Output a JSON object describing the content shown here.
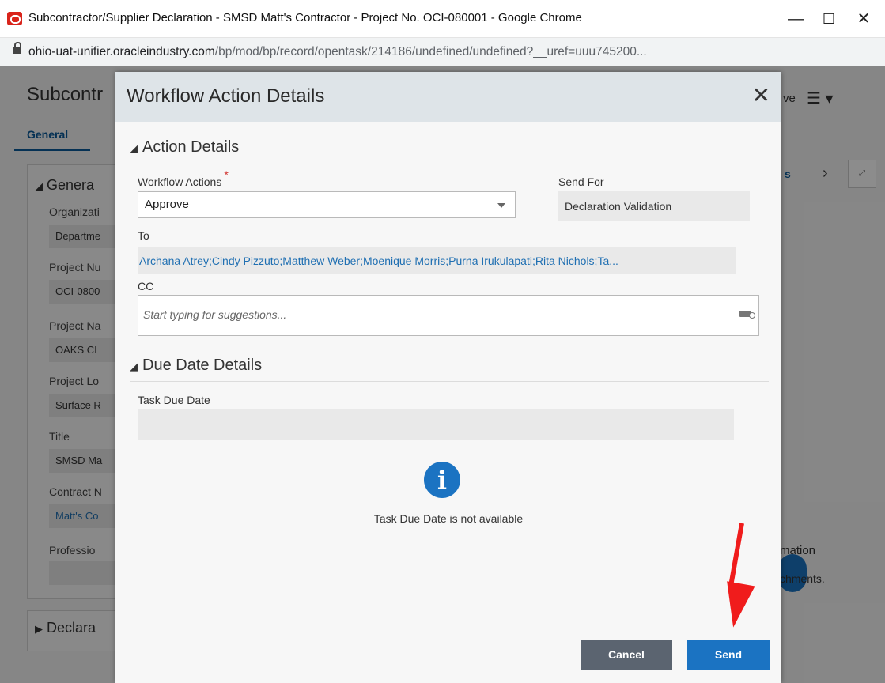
{
  "window": {
    "title": "Subcontractor/Supplier Declaration - SMSD Matt's Contractor - Project No. OCI-080001 - Google Chrome",
    "minimize": "—",
    "maximize": "☐",
    "close": "✕"
  },
  "address": {
    "domain": "ohio-uat-unifier.oracleindustry.com",
    "path": "/bp/mod/bp/record/opentask/214186/undefined/undefined?__uref=uuu745200..."
  },
  "background": {
    "title": "Subcontr",
    "tab": "General",
    "section": "Genera",
    "fields": [
      {
        "label": "Organizati",
        "value": "Departme"
      },
      {
        "label": "Project Nu",
        "value": "OCI-0800"
      },
      {
        "label": "Project Na",
        "value": "OAKS CI"
      },
      {
        "label": "Project Lo",
        "value": "Surface R"
      },
      {
        "label": "Title",
        "value": "SMSD Ma"
      },
      {
        "label": "Contract N",
        "value": "Matt's Co"
      },
      {
        "label": "Professio",
        "value": ""
      }
    ],
    "collapsed_section": "Declara",
    "right_ve": "ve",
    "right_s": "s",
    "right_mation": "mation",
    "right_chments": "chments."
  },
  "modal": {
    "title": "Workflow Action Details",
    "close": "✕",
    "action_section": "Action Details",
    "workflow_actions_label": "Workflow Actions",
    "required_mark": "*",
    "workflow_action_value": "Approve",
    "send_for_label": "Send For",
    "send_for_value": "Declaration Validation",
    "to_label": "To",
    "to_value": "Archana Atrey;Cindy Pizzuto;Matthew Weber;Moenique Morris;Purna Irukulapati;Rita Nichols;Ta...",
    "cc_label": "CC",
    "cc_placeholder": "Start typing for suggestions...",
    "due_section": "Due Date Details",
    "task_due_label": "Task Due Date",
    "info_glyph": "i",
    "due_na_text": "Task Due Date is not available",
    "cancel": "Cancel",
    "send": "Send"
  },
  "colors": {
    "primary": "#1b73c2",
    "cancel": "#5b6470",
    "arrow": "#f01c1c",
    "link": "#1f6fb2"
  }
}
